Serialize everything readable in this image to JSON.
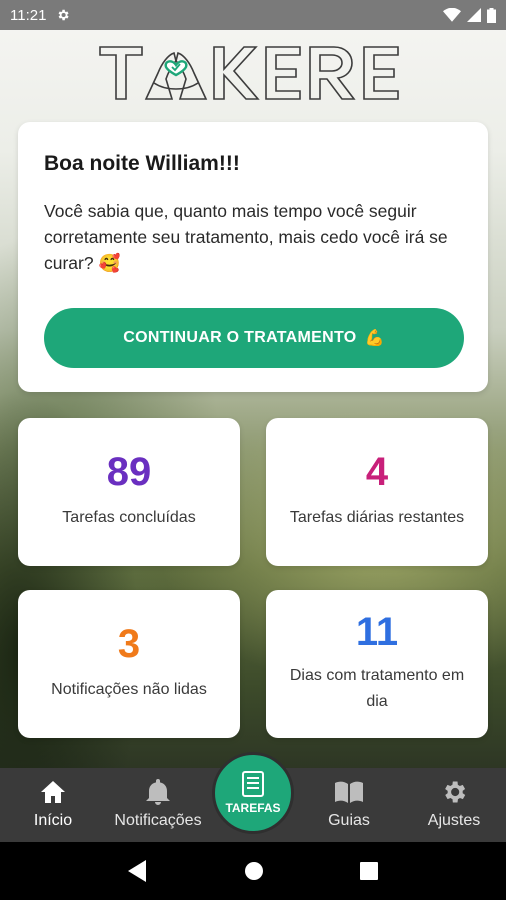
{
  "status_bar": {
    "time": "11:21"
  },
  "logo": {
    "text": "TAKERE"
  },
  "welcome": {
    "greeting": "Boa noite William!!!",
    "message": "Você sabia que, quanto mais tempo você seguir corretamente seu tratamento, mais cedo você irá se curar? 🥰",
    "cta_label": "CONTINUAR O TRATAMENTO",
    "cta_emoji": "💪"
  },
  "stats": [
    {
      "value": "89",
      "label": "Tarefas concluídas",
      "color": "#6a2fc0"
    },
    {
      "value": "4",
      "label": "Tarefas diárias restantes",
      "color": "#c8207a"
    },
    {
      "value": "3",
      "label": "Notificações não lidas",
      "color": "#f07a1a"
    },
    {
      "value": "11",
      "label": "Dias com tratamento em dia",
      "color": "#2f6fe0"
    }
  ],
  "nav": {
    "inicio": "Início",
    "notificacoes": "Notificações",
    "tarefas": "TAREFAS",
    "guias": "Guias",
    "ajustes": "Ajustes"
  },
  "colors": {
    "accent": "#1ea779",
    "nav_bg": "#3a3a3a"
  }
}
